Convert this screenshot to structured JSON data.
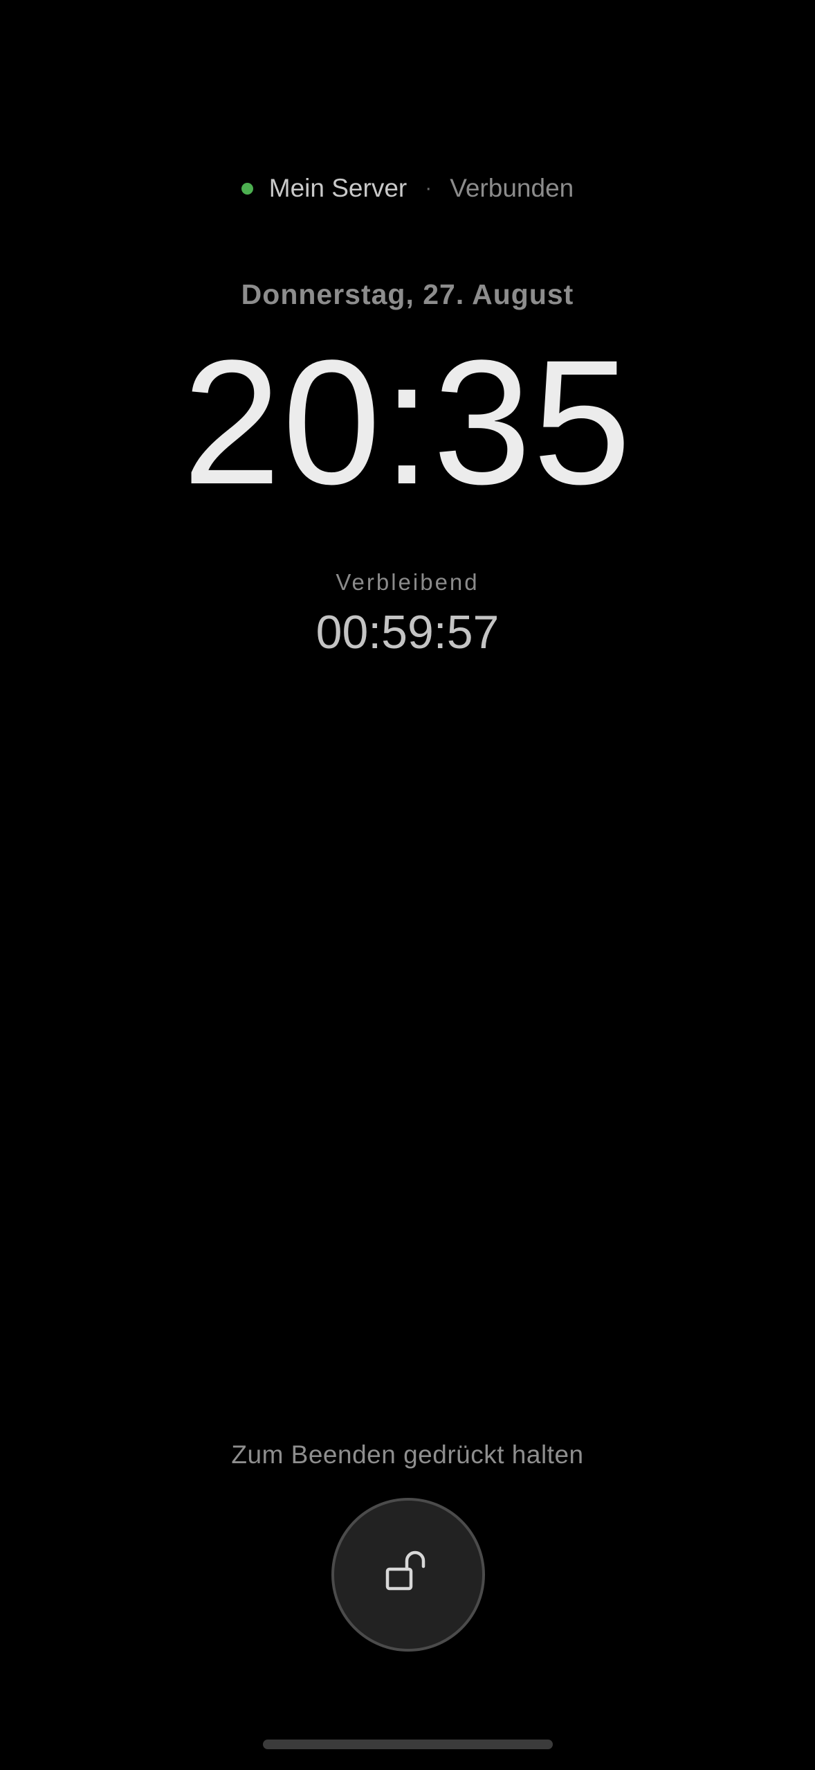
{
  "status": {
    "server_name": "Mein Server",
    "separator": "·",
    "connection_state": "Verbunden",
    "connection_color": "#4caf50"
  },
  "clock": {
    "date": "Donnerstag, 27. August",
    "time": "20:35"
  },
  "timer": {
    "label": "Verbleibend",
    "remaining": "00:59:57"
  },
  "controls": {
    "hold_hint": "Zum Beenden gedrückt halten",
    "unlock_icon": "unlock-icon"
  }
}
